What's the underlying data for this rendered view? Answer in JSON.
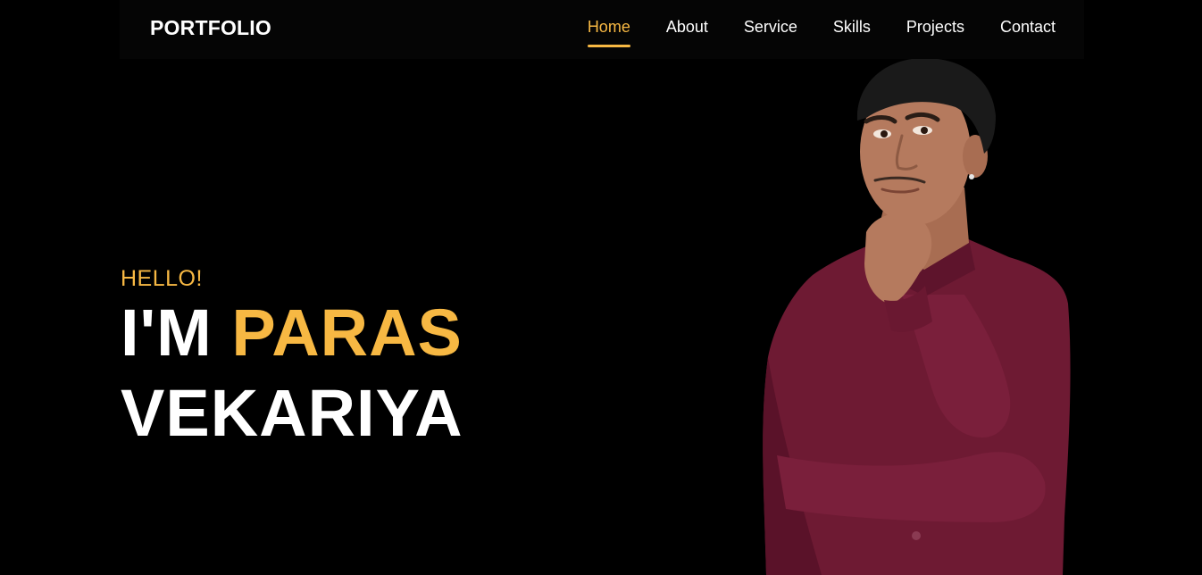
{
  "navbar": {
    "brand": "PORTFOLIO",
    "links": [
      {
        "label": "Home",
        "active": true
      },
      {
        "label": "About",
        "active": false
      },
      {
        "label": "Service",
        "active": false
      },
      {
        "label": "Skills",
        "active": false
      },
      {
        "label": "Projects",
        "active": false
      },
      {
        "label": "Contact",
        "active": false
      }
    ]
  },
  "hero": {
    "greeting": "HELLO!",
    "intro": "I'M",
    "first_name": "PARAS",
    "last_name": "VEKARIYA"
  },
  "colors": {
    "background": "#000000",
    "navbar_bg": "#050505",
    "accent": "#f7b843",
    "text": "#ffffff",
    "shirt": "#6e1a33",
    "skin": "#b57a5e",
    "hair": "#1a1a1a"
  }
}
